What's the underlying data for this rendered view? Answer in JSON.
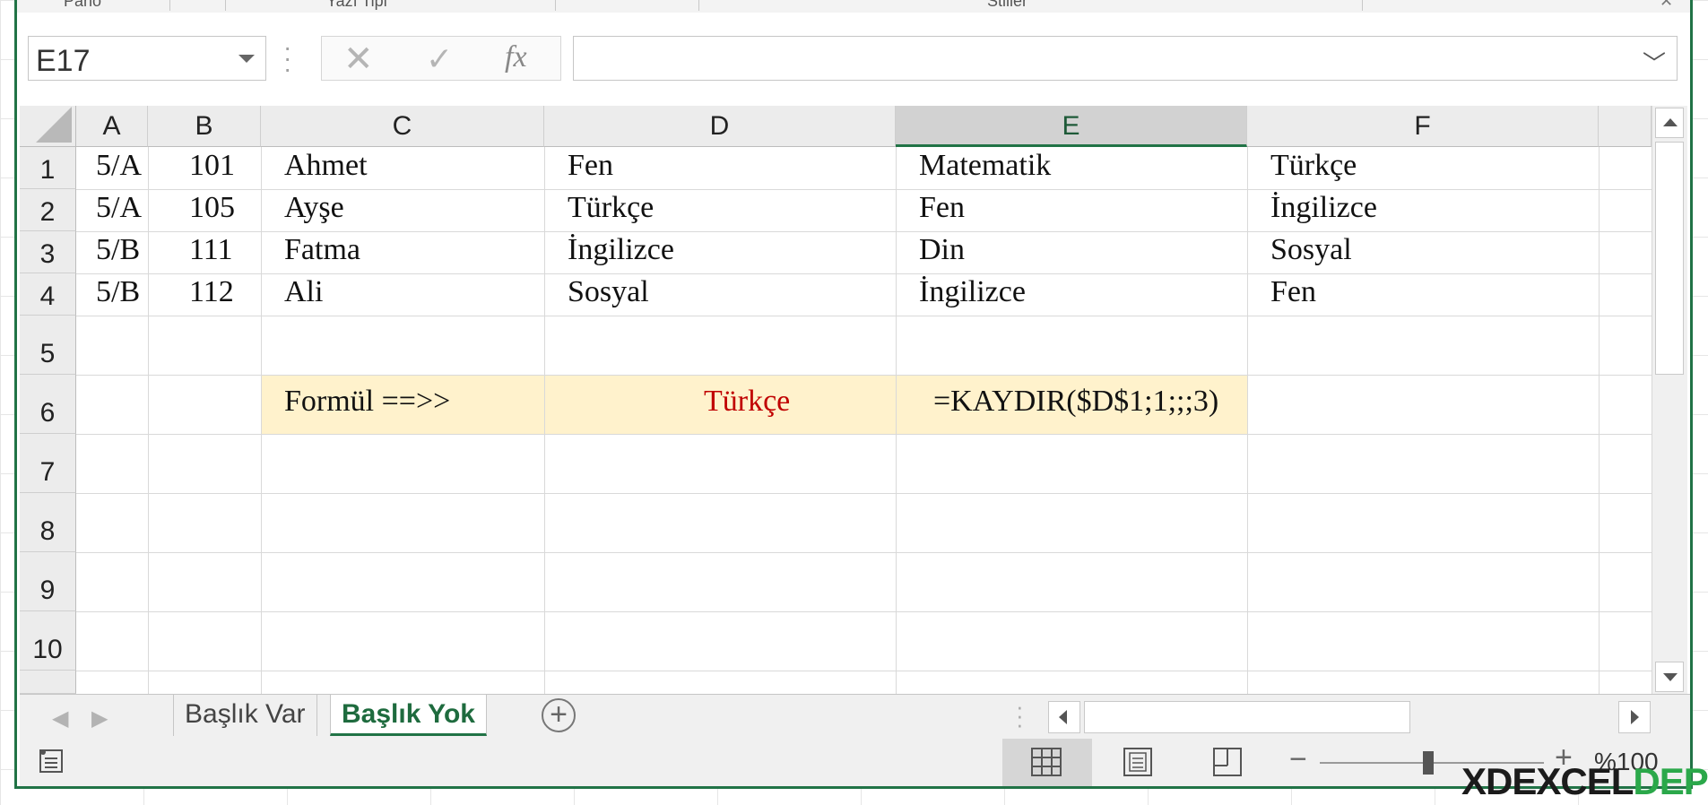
{
  "ribbon": {
    "groups": [
      "Pano",
      "Yazı Tipi",
      "Stiller"
    ]
  },
  "formula_bar": {
    "name_box": "E17",
    "cancel_symbol": "✕",
    "enter_symbol": "✓",
    "fx_label": "fx",
    "formula_value": ""
  },
  "columns": [
    {
      "label": "A",
      "selected": false
    },
    {
      "label": "B",
      "selected": false
    },
    {
      "label": "C",
      "selected": false
    },
    {
      "label": "D",
      "selected": false
    },
    {
      "label": "E",
      "selected": true
    },
    {
      "label": "F",
      "selected": false
    }
  ],
  "rows": [
    "1",
    "2",
    "3",
    "4",
    "5",
    "6",
    "7",
    "8",
    "9",
    "10"
  ],
  "cells": {
    "r1": {
      "a": "5/A",
      "b": "101",
      "c": "Ahmet",
      "d": "Fen",
      "e": "Matematik",
      "f": "Türkçe"
    },
    "r2": {
      "a": "5/A",
      "b": "105",
      "c": "Ayşe",
      "d": "Türkçe",
      "e": "Fen",
      "f": "İngilizce"
    },
    "r3": {
      "a": "5/B",
      "b": "111",
      "c": "Fatma",
      "d": "İngilizce",
      "e": "Din",
      "f": "Sosyal"
    },
    "r4": {
      "a": "5/B",
      "b": "112",
      "c": "Ali",
      "d": "Sosyal",
      "e": "İngilizce",
      "f": "Fen"
    },
    "r6": {
      "c": "Formül ==>>",
      "d": "Türkçe",
      "e": "=KAYDIR($D$1;1;;;3)"
    }
  },
  "colors": {
    "accent": "#217346",
    "highlight_fill": "#fff2cc",
    "result_text": "#c00000"
  },
  "sheet_tabs": [
    {
      "label": "Başlık Var",
      "active": false
    },
    {
      "label": "Başlık Yok",
      "active": true
    }
  ],
  "status_bar": {
    "zoom_label": "%100",
    "zoom_minus": "−",
    "zoom_plus": "+"
  },
  "watermark": {
    "prefix": "XDEXCEL",
    "suffix": "DEPO"
  },
  "icons": {
    "add_sheet": "plus-icon",
    "prev_sheet": "chevron-left-icon",
    "next_sheet": "chevron-right-icon",
    "formula_dropdown": "chevron-down-icon"
  }
}
